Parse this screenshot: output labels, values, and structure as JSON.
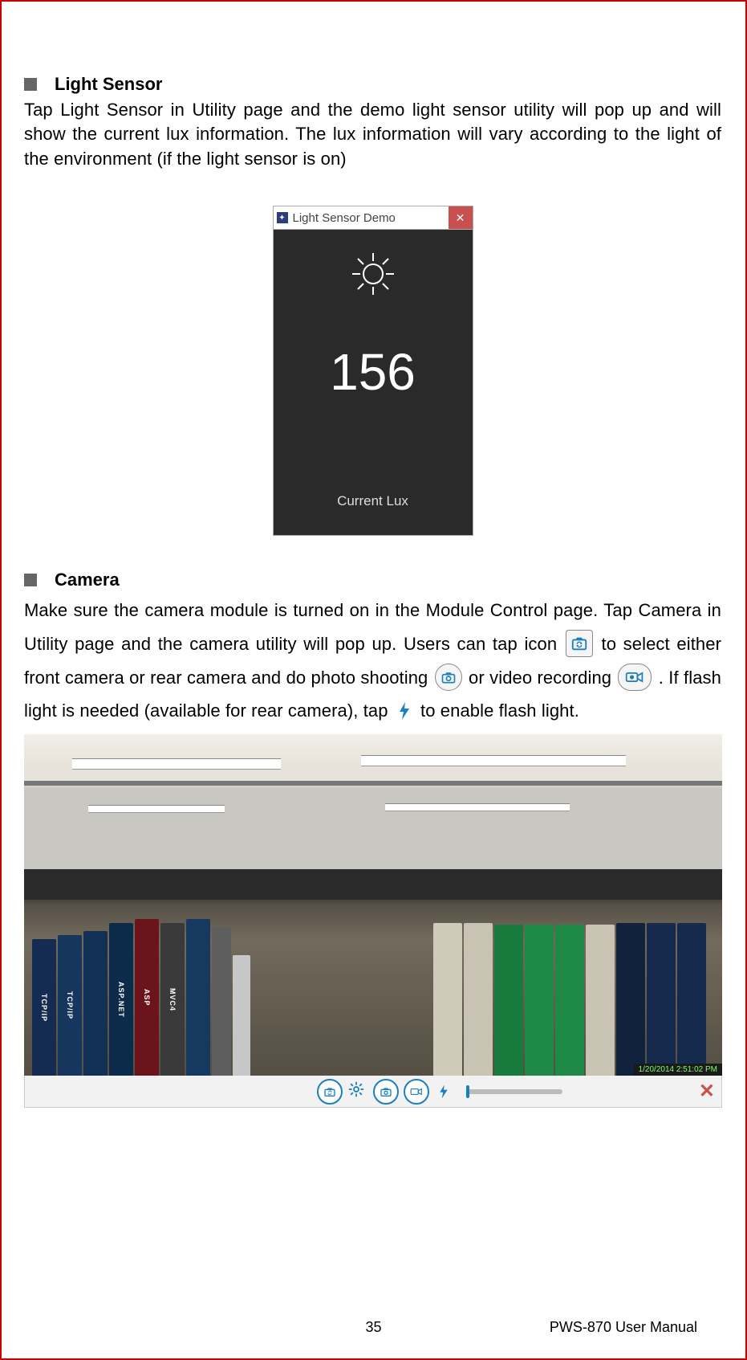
{
  "sections": {
    "light_sensor": {
      "heading": "Light Sensor",
      "body": "Tap Light Sensor in Utility page and the demo light sensor utility will pop up and will show the current lux information. The lux information will vary according to the light of the environment (if the light sensor is on)"
    },
    "camera": {
      "heading": "Camera",
      "p1a": "Make sure the camera module is turned on in the Module Control page. Tap Camera in Utility page and the camera utility will pop up. Users can tap icon",
      "p1b": "to select either front camera or rear camera and do photo shooting",
      "p1c": "or video recording",
      "p1d": ". If flash light is needed (available for rear camera), tap",
      "p1e": "to enable flash light."
    }
  },
  "ls_demo": {
    "title": "Light Sensor Demo",
    "value": "156",
    "label": "Current Lux"
  },
  "camera_shot": {
    "timestamp": "1/20/2014 2:51:02 PM"
  },
  "icons": {
    "switch_camera": "switch-camera-icon",
    "photo": "camera-photo-icon",
    "video": "video-record-icon",
    "flash": "flash-icon",
    "gear": "gear-icon",
    "close": "close-icon"
  },
  "footer": {
    "page": "35",
    "doc": "PWS-870 User Manual"
  }
}
